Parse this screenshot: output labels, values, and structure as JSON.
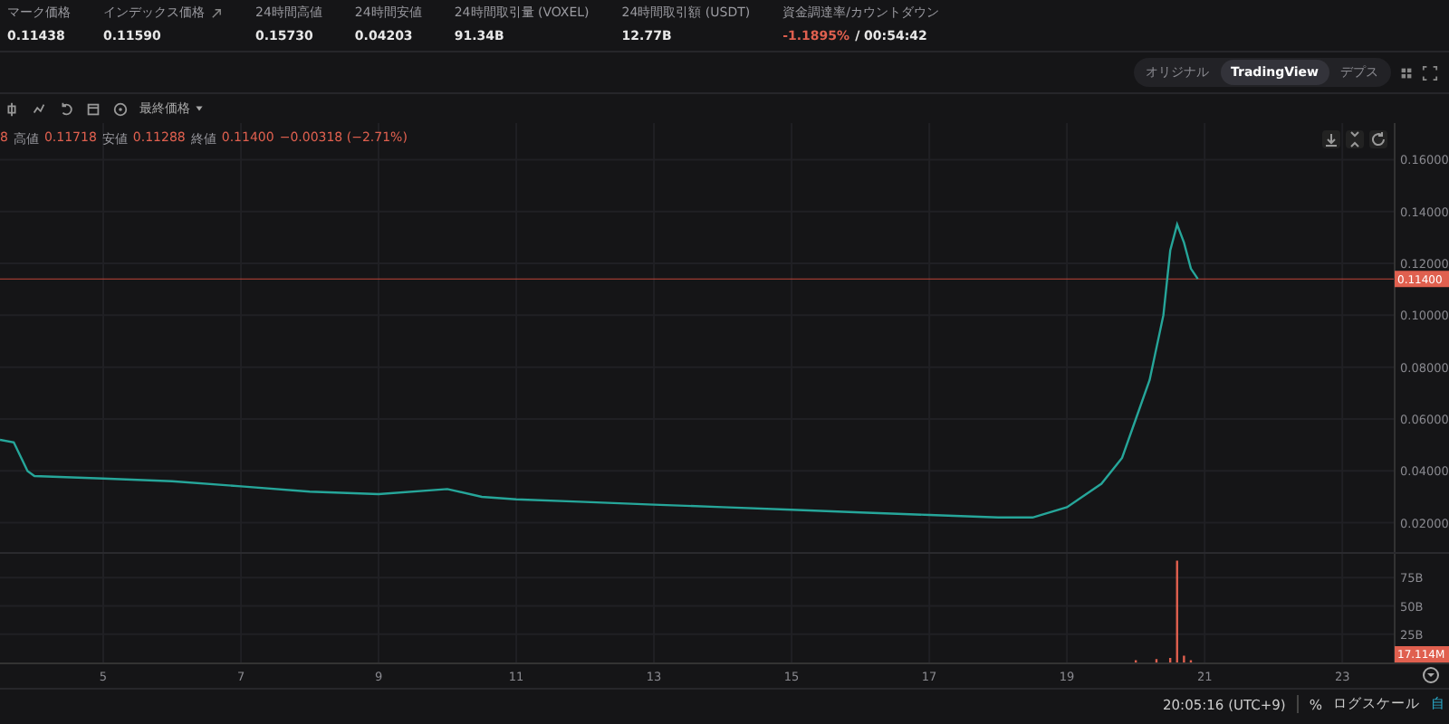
{
  "stats": [
    {
      "label": "マーク価格",
      "value": "0.11438"
    },
    {
      "label": "インデックス価格",
      "value": "0.11590",
      "link_icon": true
    },
    {
      "label": "24時間高値",
      "value": "0.15730"
    },
    {
      "label": "24時間安値",
      "value": "0.04203"
    },
    {
      "label": "24時間取引量 (VOXEL)",
      "value": "91.34B"
    },
    {
      "label": "24時間取引額 (USDT)",
      "value": "12.77B"
    },
    {
      "label": "資金調達率/カウントダウン",
      "value": "-1.1895%",
      "value2": "/ 00:54:42",
      "kind": "funding"
    }
  ],
  "view_tabs": [
    {
      "label": "オリジナル",
      "selected": false
    },
    {
      "label": "TradingView",
      "selected": true
    },
    {
      "label": "デプス",
      "selected": false
    }
  ],
  "chart_toolbar": {
    "price_source": "最終価格"
  },
  "legend": [
    {
      "value": "8"
    },
    {
      "label": "高値",
      "value": "0.11718"
    },
    {
      "label": "安値",
      "value": "0.11288"
    },
    {
      "label": "終値",
      "value": "0.11400"
    },
    {
      "value": "−0.00318 (−2.71%)"
    }
  ],
  "price_pane": {
    "current_price": "0.11400",
    "chart_data": {
      "type": "line",
      "xlim": [
        3.5,
        24.55
      ],
      "ylim": [
        0.0087,
        0.1741
      ],
      "grid": true,
      "ref_lines": [
        {
          "axis": "y",
          "value": 0.114,
          "color": "#c0463a"
        }
      ],
      "x": [
        3.5,
        3.7,
        3.9,
        4,
        5,
        6,
        7,
        8,
        9,
        10,
        10.5,
        11,
        12,
        13,
        14,
        15,
        16,
        17,
        18,
        18.5,
        19,
        19.5,
        19.8,
        20,
        20.2,
        20.4,
        20.5,
        20.6,
        20.7,
        20.8,
        20.9
      ],
      "series": [
        {
          "color": "#26a69a",
          "values": [
            0.052,
            0.051,
            0.04,
            0.038,
            0.037,
            0.036,
            0.034,
            0.032,
            0.031,
            0.033,
            0.03,
            0.029,
            0.028,
            0.027,
            0.026,
            0.025,
            0.024,
            0.023,
            0.022,
            0.022,
            0.026,
            0.035,
            0.045,
            0.06,
            0.075,
            0.1,
            0.125,
            0.135,
            0.128,
            0.118,
            0.114
          ]
        }
      ],
      "yticks": [
        {
          "value": 0.02,
          "label": "0.02000"
        },
        {
          "value": 0.04,
          "label": "0.04000"
        },
        {
          "value": 0.06,
          "label": "0.06000"
        },
        {
          "value": 0.08,
          "label": "0.08000"
        },
        {
          "value": 0.1,
          "label": "0.10000"
        },
        {
          "value": 0.12,
          "label": "0.12000"
        },
        {
          "value": 0.14,
          "label": "0.14000"
        },
        {
          "value": 0.16,
          "label": "0.16000"
        }
      ]
    }
  },
  "volume_pane": {
    "current_volume": "17.114M",
    "chart_data": {
      "type": "bar",
      "xlim": [
        3.5,
        24.55
      ],
      "ylim": [
        0,
        96
      ],
      "grid": true,
      "x": [
        20,
        20.3,
        20.5,
        20.6,
        20.7,
        20.8
      ],
      "series": [
        {
          "color": "#e0604f",
          "values": [
            2,
            3,
            4,
            90,
            6,
            2
          ]
        }
      ],
      "yticks": [
        {
          "value": 25,
          "label": "25B"
        },
        {
          "value": 50,
          "label": "50B"
        },
        {
          "value": 75,
          "label": "75B"
        }
      ],
      "xticks": [
        5,
        7,
        9,
        11,
        13,
        15,
        17,
        19,
        21,
        23
      ]
    }
  },
  "bottom_bar": {
    "time": "20:05:16 (UTC+9)",
    "percent": "%",
    "log_scale": "ログスケール",
    "auto": "自"
  }
}
